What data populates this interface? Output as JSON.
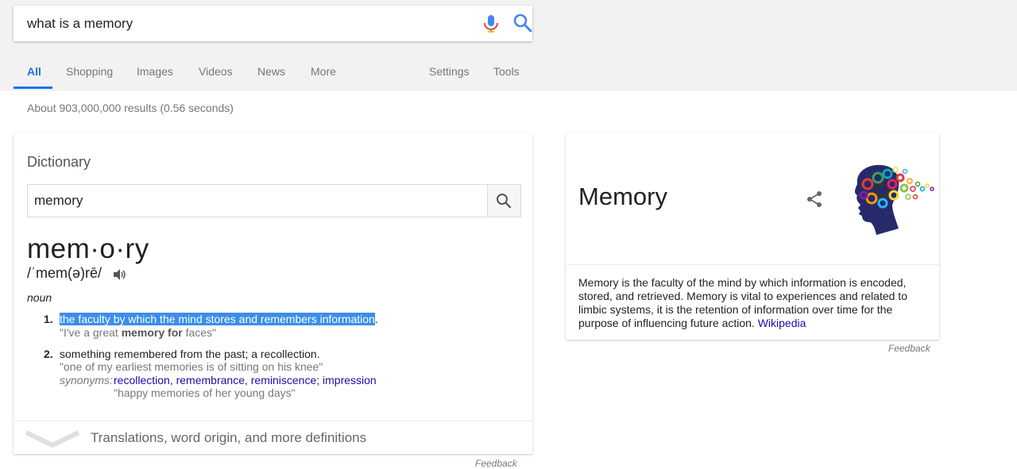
{
  "search": {
    "query": "what is a memory"
  },
  "tabs": {
    "all": "All",
    "shopping": "Shopping",
    "images": "Images",
    "videos": "Videos",
    "news": "News",
    "more": "More",
    "settings": "Settings",
    "tools": "Tools"
  },
  "results": {
    "stats": "About 903,000,000 results (0.56 seconds)"
  },
  "dictionary": {
    "title": "Dictionary",
    "search_value": "memory",
    "headword": "mem·o·ry",
    "pronunciation": "/ˈmem(ə)rē/",
    "part_of_speech": "noun",
    "definitions": [
      {
        "num": "1.",
        "text": "the faculty by which the mind stores and remembers information",
        "trail": ".",
        "example_pre": "\"I've a great ",
        "example_bold": "memory for",
        "example_post": " faces\""
      },
      {
        "num": "2.",
        "text": "something remembered from the past; a recollection.",
        "example": "\"one of my earliest memories is of sitting on his knee\"",
        "synonyms_label": "synonyms:",
        "synonyms": [
          "recollection",
          "remembrance",
          "reminiscence",
          "impression"
        ],
        "synonym_seps": [
          ",",
          ",",
          ";"
        ],
        "example2": "\"happy memories of her young days\""
      }
    ],
    "more_text": "Translations, word origin, and more definitions"
  },
  "knowledge_panel": {
    "title": "Memory",
    "description": "Memory is the faculty of the mind by which information is encoded, stored, and retrieved. Memory is vital to experiences and related to limbic systems, it is the retention of information over time for the purpose of influencing future action.",
    "source_link": "Wikipedia",
    "feedback": "Feedback"
  },
  "bottom_feedback": "Feedback",
  "colors": {
    "accent": "#1a73e8",
    "link": "#1a0dab",
    "highlight": "#3b8eea"
  },
  "icons": [
    "mic-icon",
    "search-icon",
    "speaker-icon",
    "share-icon",
    "chevron-down-icon",
    "brain-gears-image"
  ]
}
